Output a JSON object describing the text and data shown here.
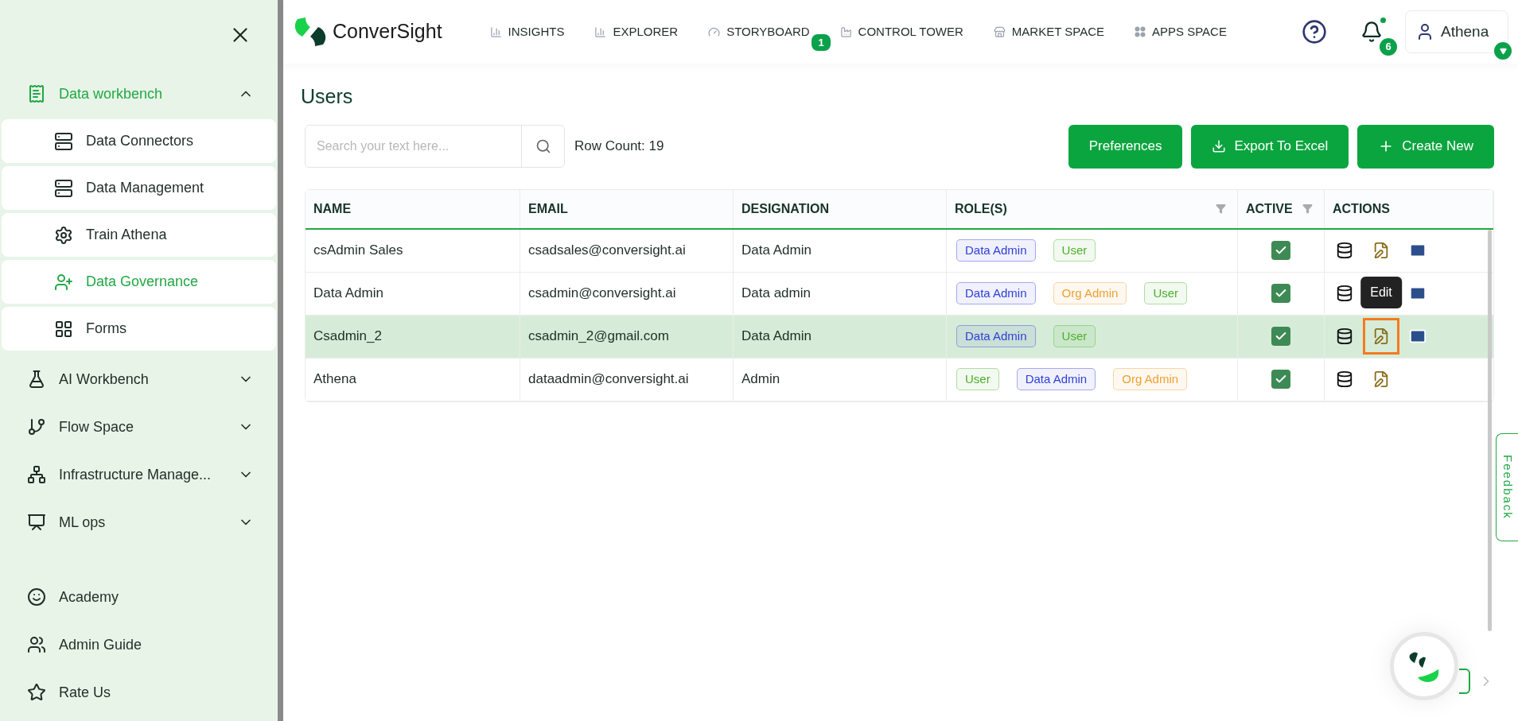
{
  "sidebar": {
    "groups": [
      {
        "label": "Data workbench",
        "selected": true,
        "expanded": true,
        "children": [
          {
            "label": "Data Connectors",
            "selected": false
          },
          {
            "label": "Data Management",
            "selected": false
          },
          {
            "label": "Train Athena",
            "selected": false
          },
          {
            "label": "Data Governance",
            "selected": true
          },
          {
            "label": "Forms",
            "selected": false
          }
        ]
      },
      {
        "label": "AI Workbench",
        "selected": false,
        "expanded": false
      },
      {
        "label": "Flow Space",
        "selected": false,
        "expanded": false
      },
      {
        "label": "Infrastructure Manage...",
        "selected": false,
        "expanded": false
      },
      {
        "label": "ML ops",
        "selected": false,
        "expanded": false
      }
    ],
    "footer_links": [
      "Academy",
      "Admin Guide",
      "Rate Us"
    ]
  },
  "header": {
    "logo": "ConverSight",
    "nav": [
      {
        "label": "INSIGHTS"
      },
      {
        "label": "EXPLORER"
      },
      {
        "label": "STORYBOARD",
        "badge": "1"
      },
      {
        "label": "CONTROL TOWER"
      },
      {
        "label": "MARKET SPACE"
      },
      {
        "label": "APPS SPACE"
      }
    ],
    "notifications": "6",
    "user": "Athena"
  },
  "page": {
    "title": "Users",
    "search": {
      "placeholder": "Search your text here..."
    },
    "row_count": "Row Count: 19",
    "buttons": [
      "Preferences",
      "Export To Excel",
      "Create New"
    ]
  },
  "table": {
    "columns": [
      {
        "label": "NAME",
        "filter": false
      },
      {
        "label": "EMAIL",
        "filter": false
      },
      {
        "label": "DESIGNATION",
        "filter": false
      },
      {
        "label": "ROLE(S)",
        "filter": true
      },
      {
        "label": "ACTIVE",
        "filter": true
      },
      {
        "label": "ACTIONS",
        "filter": false
      }
    ],
    "rows": [
      {
        "name": "csAdmin Sales",
        "email": "csadsales@conversight.ai",
        "designation": "Data Admin",
        "selected": false,
        "active": true,
        "roles": [
          {
            "label": "Data Admin",
            "color": "#2f3fd6"
          },
          {
            "label": "User",
            "color": "#4caf2a"
          }
        ],
        "actions": [
          {
            "kind": "database",
            "focused": false
          },
          {
            "kind": "edit",
            "focused": false
          },
          {
            "kind": "mail",
            "focused": false
          }
        ]
      },
      {
        "name": "Data Admin",
        "email": "csadmin@conversight.ai",
        "designation": "Data admin",
        "selected": false,
        "active": true,
        "roles": [
          {
            "label": "Data Admin",
            "color": "#2f3fd6"
          },
          {
            "label": "Org Admin",
            "color": "#f0a030"
          },
          {
            "label": "User",
            "color": "#4caf2a"
          }
        ],
        "actions": [
          {
            "kind": "database",
            "focused": false
          },
          {
            "kind": "mail",
            "focused": false
          }
        ]
      },
      {
        "name": "Csadmin_2",
        "email": "csadmin_2@gmail.com",
        "designation": "Data Admin",
        "selected": true,
        "active": true,
        "roles": [
          {
            "label": "Data Admin",
            "color": "#2f3fd6"
          },
          {
            "label": "User",
            "color": "#4caf2a"
          }
        ],
        "actions": [
          {
            "kind": "database",
            "focused": false
          },
          {
            "kind": "edit",
            "focused": true,
            "tooltip": "Edit"
          },
          {
            "kind": "mail",
            "focused": false
          }
        ]
      },
      {
        "name": "Athena",
        "email": "dataadmin@conversight.ai",
        "designation": "Admin",
        "selected": false,
        "active": true,
        "roles": [
          {
            "label": "User",
            "color": "#4caf2a"
          },
          {
            "label": "Data Admin",
            "color": "#2f3fd6"
          },
          {
            "label": "Org Admin",
            "color": "#f0a030"
          }
        ],
        "actions": [
          {
            "kind": "database",
            "focused": false
          },
          {
            "kind": "edit",
            "focused": false
          }
        ]
      }
    ]
  },
  "feedback": "Feedback"
}
